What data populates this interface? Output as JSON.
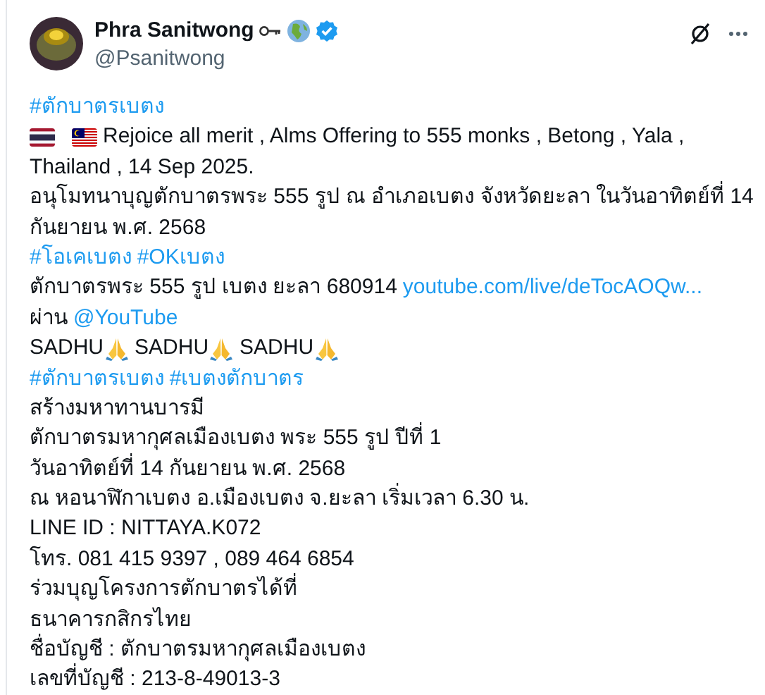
{
  "author": {
    "name": "Phra Sanitwong",
    "handle": "@Psanitwong",
    "verified": true
  },
  "lines": [
    [
      {
        "kind": "link",
        "text": "#ตักบาตรเบตง"
      }
    ],
    [
      {
        "kind": "flag-th"
      },
      {
        "kind": "flag-my"
      },
      {
        "kind": "text",
        "text": "Rejoice all merit , Alms Offering to 555 monks , Betong , Yala ,"
      }
    ],
    [
      {
        "kind": "text",
        "text": "Thailand , 14 Sep 2025."
      }
    ],
    [
      {
        "kind": "text",
        "text": "อนุโมทนาบุญตักบาตรพระ 555 รูป ณ อำเภอเบตง จังหวัดยะลา ในวันอาทิตย์ที่ 14"
      }
    ],
    [
      {
        "kind": "text",
        "text": "กันยายน พ.ศ. 2568"
      }
    ],
    [
      {
        "kind": "link",
        "text": "#โอเคเบตง"
      },
      {
        "kind": "link",
        "text": "#OKเบตง"
      }
    ],
    [
      {
        "kind": "text",
        "text": "ตักบาตรพระ 555 รูป เบตง ยะลา 680914"
      },
      {
        "kind": "link",
        "text": "youtube.com/live/deTocAOQw..."
      }
    ],
    [
      {
        "kind": "text",
        "text": "ผ่าน"
      },
      {
        "kind": "link",
        "text": "@YouTube"
      }
    ],
    [
      {
        "kind": "text",
        "text": "SADHU"
      },
      {
        "kind": "pray"
      },
      {
        "kind": "text",
        "text": "SADHU"
      },
      {
        "kind": "pray"
      },
      {
        "kind": "text",
        "text": "SADHU"
      },
      {
        "kind": "pray"
      }
    ],
    [
      {
        "kind": "link",
        "text": "#ตักบาตรเบตง"
      },
      {
        "kind": "link",
        "text": "#เบตงตักบาตร"
      }
    ],
    [
      {
        "kind": "text",
        "text": "สร้างมหาทานบารมี"
      }
    ],
    [
      {
        "kind": "text",
        "text": "ตักบาตรมหากุศลเมืองเบตง พระ 555 รูป ปีที่ 1"
      }
    ],
    [
      {
        "kind": "text",
        "text": "วันอาทิตย์ที่ 14 กันยายน พ.ศ. 2568"
      }
    ],
    [
      {
        "kind": "text",
        "text": "ณ หอนาฬิกาเบตง อ.เมืองเบตง จ.ยะลา เริ่มเวลา 6.30 น."
      }
    ],
    [
      {
        "kind": "text",
        "text": "LINE ID : NITTAYA.K072"
      }
    ],
    [
      {
        "kind": "text",
        "text": "โทร. 081 415 9397 , 089 464 6854"
      }
    ],
    [
      {
        "kind": "text",
        "text": "ร่วมบุญโครงการตักบาตรได้ที่"
      }
    ],
    [
      {
        "kind": "text",
        "text": "ธนาคารกสิกรไทย"
      }
    ],
    [
      {
        "kind": "text",
        "text": "ชื่อบัญชี : ตักบาตรมหากุศลเมืองเบตง"
      }
    ],
    [
      {
        "kind": "text",
        "text": "เลขที่บัญชี : 213-8-49013-3"
      }
    ]
  ]
}
